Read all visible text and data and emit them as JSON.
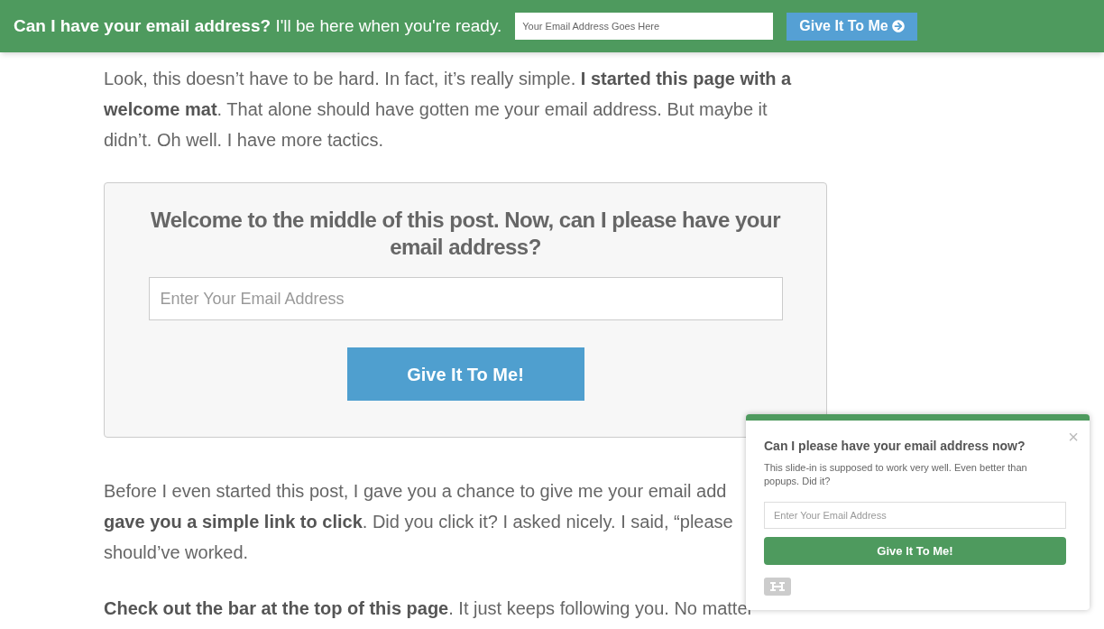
{
  "top_bar": {
    "headline": "**Can I have your email address?** I'll be here when you're ready.",
    "email_placeholder": "Your Email Address Goes Here",
    "button": "Give It To Me"
  },
  "paragraphs": [
    {
      "lines": [
        "Look, this doesn’t have to be hard. In fact, it’s really simple. **I started this page with a**",
        "**welcome mat**. That alone should have gotten me your email address. But maybe it",
        "didn’t. Oh well. I have more tactics."
      ]
    }
  ],
  "optin_box": {
    "heading": "Welcome to the middle of this post. Now, can I please have your email address?",
    "email_placeholder": "Enter Your Email Address",
    "button": "Give It To Me!"
  },
  "paragraphs_after": [
    {
      "lines": [
        "Before I even started this post, I gave you a chance to give me your email add",
        "**gave you a simple link to click**. Did you click it? I asked nicely. I said, “please",
        "should’ve worked."
      ]
    },
    {
      "lines": [
        "**Check out the bar at the top of this page**. It just keeps following you. No matter"
      ]
    }
  ],
  "slide_in": {
    "title": "Can I please have your email address now?",
    "text": "This slide-in is supposed to work very well. Even better than popups. Did it?",
    "email_placeholder": "Enter Your Email Address",
    "button": "Give It To Me!",
    "close": "×"
  }
}
